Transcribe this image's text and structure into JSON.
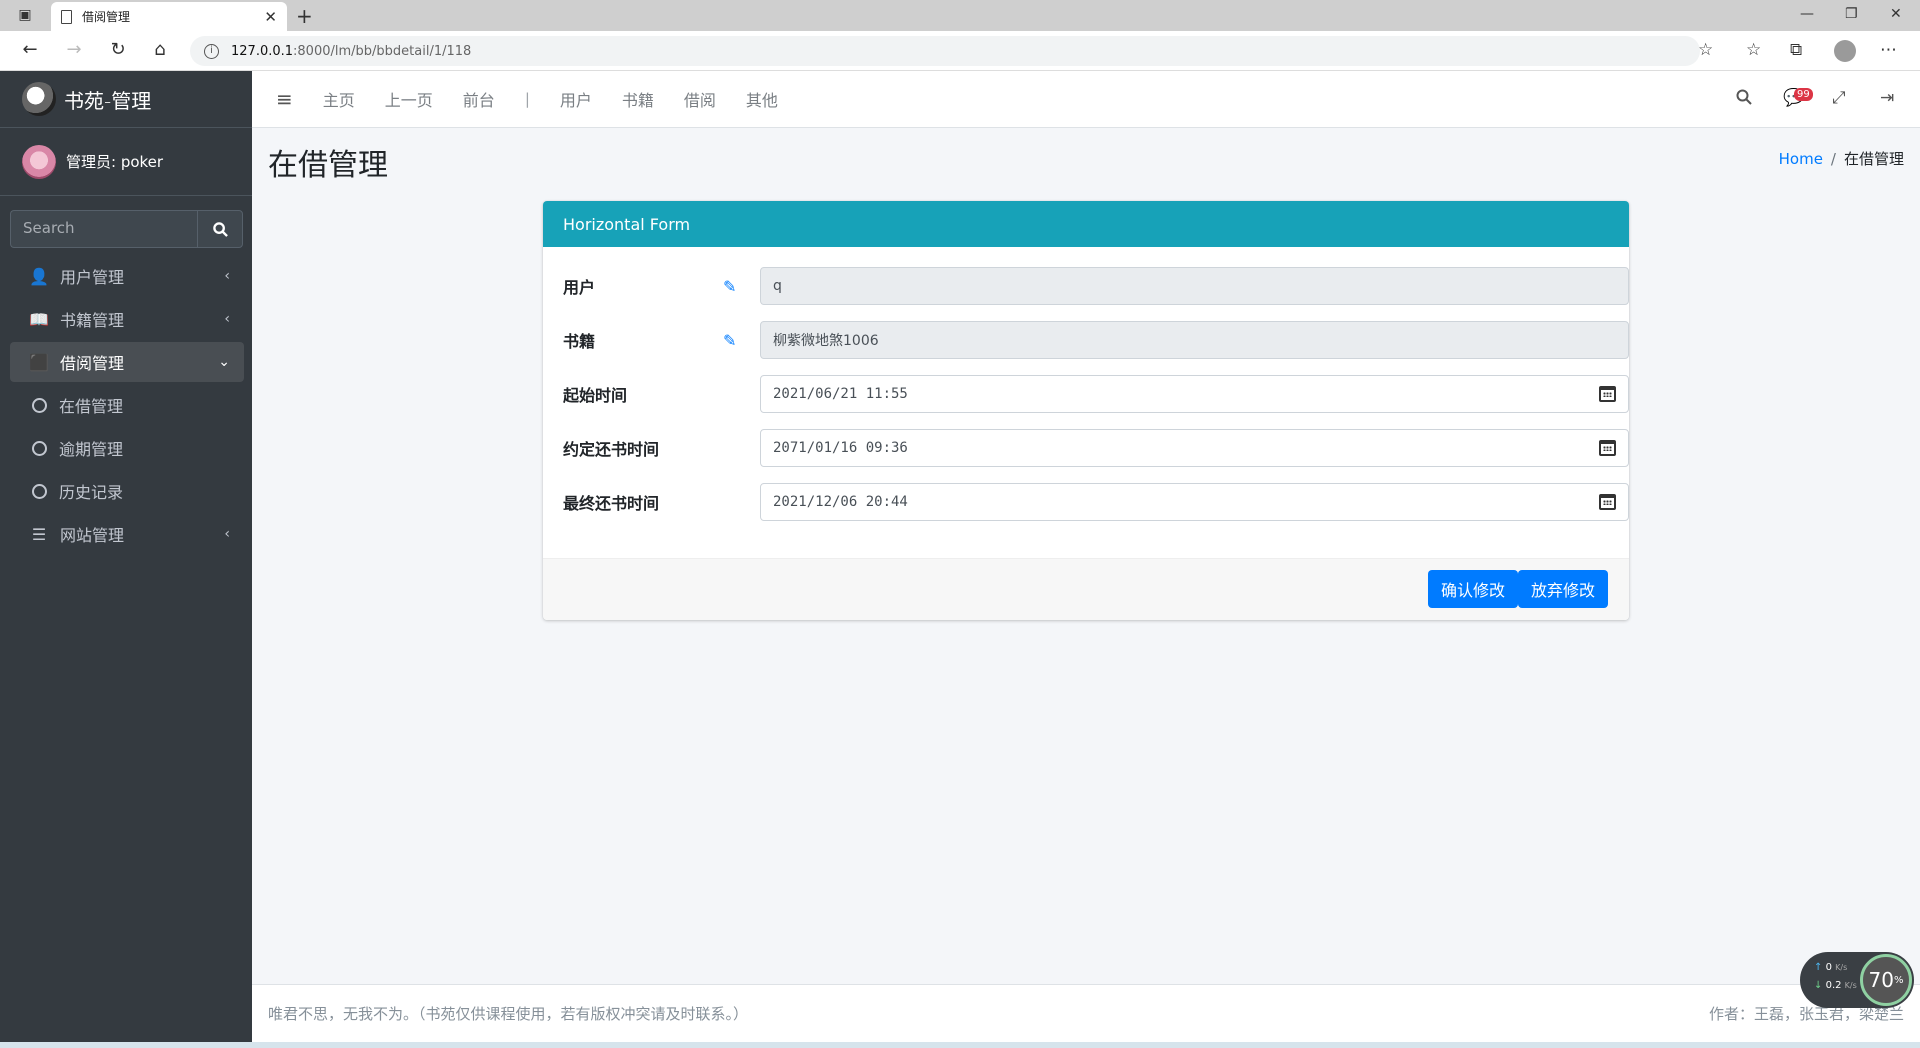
{
  "browser": {
    "tab_title": "借阅管理",
    "url_host": "127.0.0.1",
    "url_path": ":8000/lm/bb/bbdetail/1/118"
  },
  "sidebar": {
    "brand": "书苑-管理",
    "user": "管理员: poker",
    "search_placeholder": "Search",
    "items": [
      {
        "label": "用户管理",
        "icon": "user-icon"
      },
      {
        "label": "书籍管理",
        "icon": "book-icon"
      },
      {
        "label": "借阅管理",
        "icon": "reader-icon"
      },
      {
        "label": "在借管理",
        "icon": "circle-icon"
      },
      {
        "label": "逾期管理",
        "icon": "circle-icon"
      },
      {
        "label": "历史记录",
        "icon": "circle-icon"
      },
      {
        "label": "网站管理",
        "icon": "bars-icon"
      }
    ]
  },
  "topnav": {
    "links": [
      "主页",
      "上一页",
      "前台",
      "用户",
      "书籍",
      "借阅",
      "其他"
    ],
    "separator": "|",
    "badge": "99"
  },
  "page": {
    "title": "在借管理",
    "breadcrumb_home": "Home",
    "breadcrumb_sep": "/",
    "breadcrumb_current": "在借管理"
  },
  "form": {
    "header": "Horizontal Form",
    "fields": [
      {
        "label": "用户",
        "value": "q"
      },
      {
        "label": "书籍",
        "value": "柳紫微地煞1006"
      },
      {
        "label": "起始时间",
        "value": "2021/06/21 11:55"
      },
      {
        "label": "约定还书时间",
        "value": "2071/01/16 09:36"
      },
      {
        "label": "最终还书时间",
        "value": "2021/12/06 20:44"
      }
    ],
    "confirm": "确认修改",
    "cancel": "放弃修改"
  },
  "footer": {
    "left": "唯君不思，无我不为。（书苑仅供课程使用，若有版权冲突请及时联系。）",
    "right": "作者：王磊，张玉君，梁楚兰"
  },
  "netmeter": {
    "up": "0",
    "down": "0.2",
    "unit": "K/s",
    "percent": "70",
    "percent_unit": "%"
  }
}
